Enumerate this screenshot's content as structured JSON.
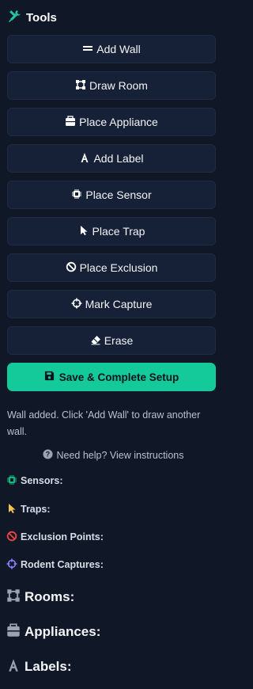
{
  "header": {
    "title": "Tools",
    "icon": "tools-icon"
  },
  "tools": [
    {
      "label": "Add Wall",
      "icon": "equals-icon"
    },
    {
      "label": "Draw Room",
      "icon": "vector-square-icon"
    },
    {
      "label": "Place Appliance",
      "icon": "toolbox-icon"
    },
    {
      "label": "Add Label",
      "icon": "font-icon"
    },
    {
      "label": "Place Sensor",
      "icon": "microchip-icon"
    },
    {
      "label": "Place Trap",
      "icon": "cursor-icon"
    },
    {
      "label": "Place Exclusion",
      "icon": "ban-icon"
    },
    {
      "label": "Mark Capture",
      "icon": "crosshairs-icon"
    },
    {
      "label": "Erase",
      "icon": "eraser-icon"
    }
  ],
  "save": {
    "label": "Save & Complete Setup",
    "color": "#14c99a"
  },
  "status": {
    "message": "Wall added. Click 'Add Wall' to draw another wall."
  },
  "help": {
    "label": "Need help? View instructions"
  },
  "sections": {
    "sensors": "Sensors:",
    "traps": "Traps:",
    "exclusions": "Exclusion Points:",
    "captures": "Rodent Captures:",
    "rooms": "Rooms:",
    "appliances": "Appliances:",
    "labels": "Labels:"
  },
  "colors": {
    "background": "#101828",
    "accent": "#14c99a",
    "sensor": "#10b981",
    "trap": "#f5c451",
    "exclusion": "#ef4444",
    "capture": "#8b7cf6"
  }
}
